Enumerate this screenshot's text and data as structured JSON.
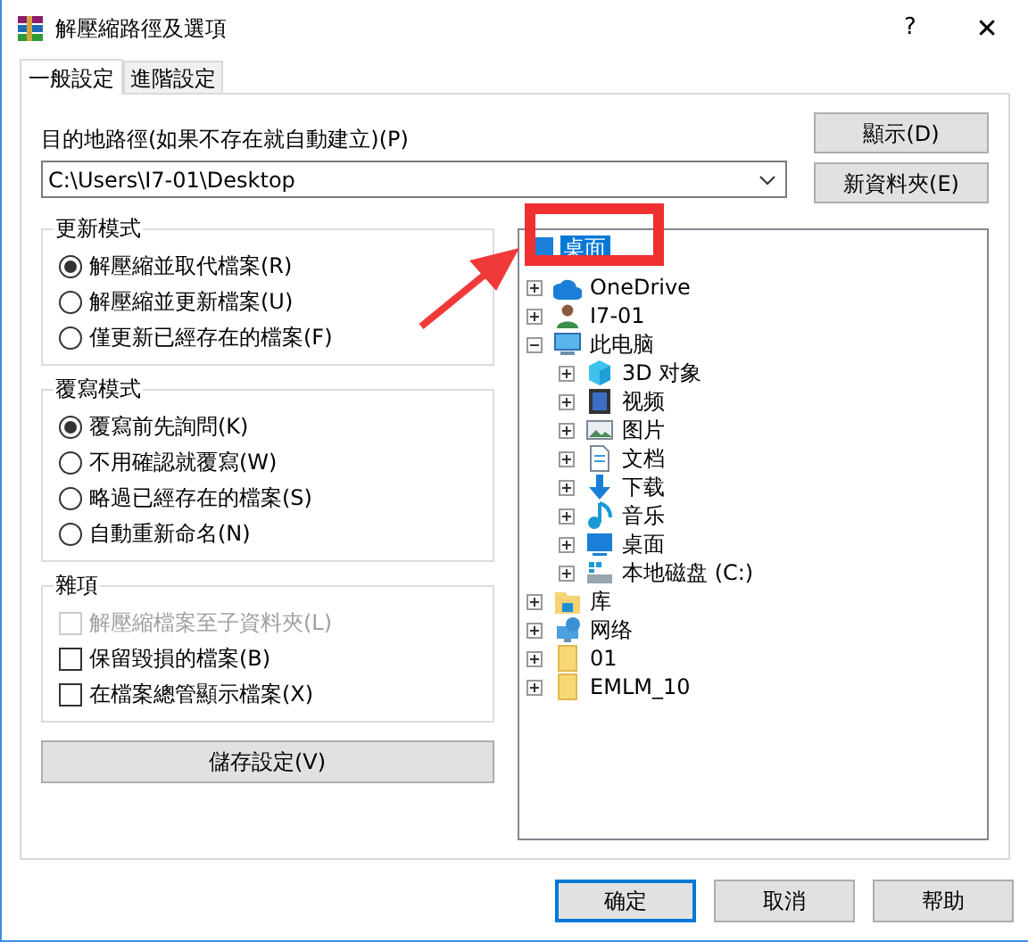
{
  "window": {
    "title": "解壓縮路徑及選項",
    "help": "?",
    "close": "✕"
  },
  "tabs": [
    {
      "label": "一般設定",
      "selected": true
    },
    {
      "label": "進階設定",
      "selected": false
    }
  ],
  "destination": {
    "label": "目的地路徑(如果不存在就自動建立)(P)",
    "value": "C:\\Users\\I7-01\\Desktop"
  },
  "side_buttons": [
    "顯示(D)",
    "新資料夾(E)"
  ],
  "groups": [
    {
      "title": "更新模式",
      "kind": "radio",
      "items": [
        {
          "label": "解壓縮並取代檔案(R)",
          "selected": true
        },
        {
          "label": "解壓縮並更新檔案(U)",
          "selected": false
        },
        {
          "label": "僅更新已經存在的檔案(F)",
          "selected": false
        }
      ]
    },
    {
      "title": "覆寫模式",
      "kind": "radio",
      "items": [
        {
          "label": "覆寫前先詢問(K)",
          "selected": true
        },
        {
          "label": "不用確認就覆寫(W)",
          "selected": false
        },
        {
          "label": "略過已經存在的檔案(S)",
          "selected": false
        },
        {
          "label": "自動重新命名(N)",
          "selected": false
        }
      ]
    },
    {
      "title": "雜項",
      "kind": "checkbox",
      "items": [
        {
          "label": "解壓縮檔案至子資料夾(L)",
          "checked": false,
          "disabled": true
        },
        {
          "label": "保留毀損的檔案(B)",
          "checked": false,
          "disabled": false
        },
        {
          "label": "在檔案總管顯示檔案(X)",
          "checked": false,
          "disabled": false
        }
      ]
    }
  ],
  "save_button": "儲存設定(V)",
  "tree": [
    {
      "label": "桌面",
      "kind": "desktop",
      "selected": true,
      "children": [
        {
          "label": "OneDrive",
          "kind": "cloud",
          "selected": false,
          "expanded": false
        },
        {
          "label": "I7-01",
          "kind": "user",
          "selected": false,
          "expanded": false
        },
        {
          "label": "此电脑",
          "kind": "computer",
          "selected": false,
          "expanded": true,
          "children": [
            {
              "label": "3D 对象",
              "kind": "cube",
              "selected": false,
              "expanded": false
            },
            {
              "label": "视频",
              "kind": "film",
              "selected": false,
              "expanded": false
            },
            {
              "label": "图片",
              "kind": "image",
              "selected": false,
              "expanded": false
            },
            {
              "label": "文档",
              "kind": "document",
              "selected": false,
              "expanded": false
            },
            {
              "label": "下载",
              "kind": "download",
              "selected": false,
              "expanded": false
            },
            {
              "label": "音乐",
              "kind": "music",
              "selected": false,
              "expanded": false
            },
            {
              "label": "桌面",
              "kind": "desktop",
              "selected": false,
              "expanded": false
            },
            {
              "label": "本地磁盘 (C:)",
              "kind": "drive",
              "selected": false,
              "expanded": false
            }
          ]
        },
        {
          "label": "库",
          "kind": "library",
          "selected": false,
          "expanded": false
        },
        {
          "label": "网络",
          "kind": "network",
          "selected": false,
          "expanded": false
        },
        {
          "label": "01",
          "kind": "folder",
          "selected": false,
          "expanded": false
        },
        {
          "label": "EMLM_10",
          "kind": "folder",
          "selected": false,
          "expanded": false
        }
      ]
    }
  ],
  "dialog_buttons": [
    {
      "label": "确定",
      "selected": true
    },
    {
      "label": "取消",
      "selected": false
    },
    {
      "label": "帮助",
      "selected": false
    }
  ],
  "annotations": {
    "highlight_box": true,
    "arrow": true
  }
}
